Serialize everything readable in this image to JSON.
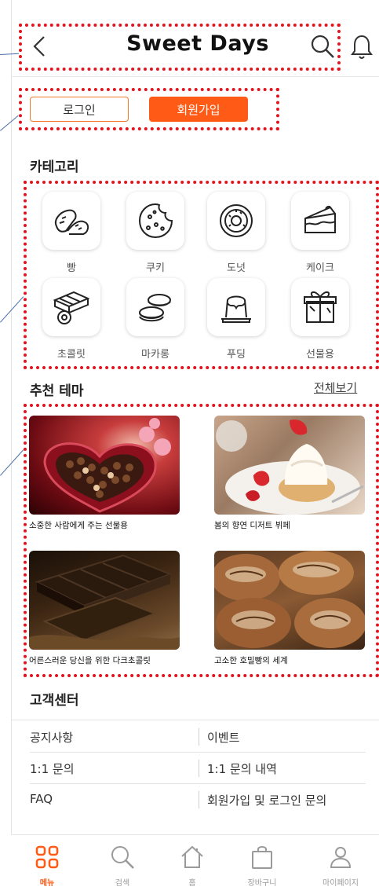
{
  "header": {
    "logo": "Sweet Days"
  },
  "auth": {
    "login_label": "로그인",
    "signup_label": "회원가입"
  },
  "categories": {
    "title": "카테고리",
    "items": [
      {
        "label": "빵",
        "icon": "bread-icon"
      },
      {
        "label": "쿠키",
        "icon": "cookie-icon"
      },
      {
        "label": "도넛",
        "icon": "donut-icon"
      },
      {
        "label": "케이크",
        "icon": "cake-icon"
      },
      {
        "label": "초콜릿",
        "icon": "chocolate-icon"
      },
      {
        "label": "마카롱",
        "icon": "macaron-icon"
      },
      {
        "label": "푸딩",
        "icon": "pudding-icon"
      },
      {
        "label": "선물용",
        "icon": "gift-icon"
      }
    ]
  },
  "themes": {
    "title": "추천 테마",
    "see_all": "전체보기",
    "items": [
      {
        "caption": "소중한 사람에게 주는 선물용"
      },
      {
        "caption": "봄의 향연 디저트 뷔페"
      },
      {
        "caption": "어른스러운 당신을 위한 다크초콜릿"
      },
      {
        "caption": "고소한 호밀빵의 세계"
      }
    ]
  },
  "customer_center": {
    "title": "고객센터",
    "rows": [
      [
        "공지사항",
        "이벤트"
      ],
      [
        "1:1 문의",
        "1:1 문의 내역"
      ],
      [
        "FAQ",
        "회원가입 및 로그인 문의"
      ]
    ]
  },
  "bottom_nav": {
    "items": [
      {
        "label": "메뉴",
        "active": true
      },
      {
        "label": "검색",
        "active": false
      },
      {
        "label": "홈",
        "active": false
      },
      {
        "label": "장바구니",
        "active": false
      },
      {
        "label": "마이페이지",
        "active": false
      }
    ]
  },
  "colors": {
    "accent": "#ff5a16",
    "annotation": "#e0141e",
    "callout": "#4a6ea9"
  }
}
